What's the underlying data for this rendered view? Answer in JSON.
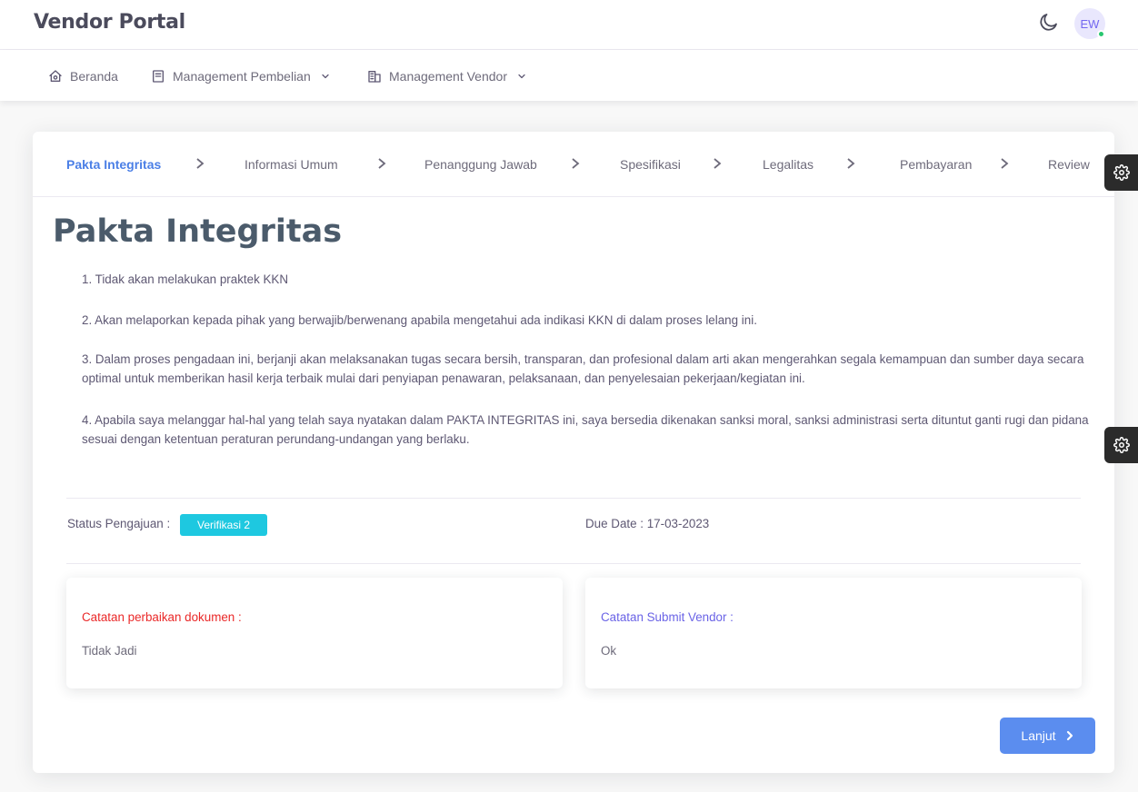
{
  "app": {
    "title": "Vendor Portal"
  },
  "user": {
    "initials": "EW",
    "status_color": "#28c76f"
  },
  "nav": {
    "items": [
      {
        "label": "Beranda",
        "icon": "home-icon"
      },
      {
        "label": "Management Pembelian",
        "icon": "document-icon",
        "has_dropdown": true
      },
      {
        "label": "Management Vendor",
        "icon": "building-icon",
        "has_dropdown": true
      }
    ]
  },
  "steps": [
    {
      "label": "Pakta Integritas",
      "active": true
    },
    {
      "label": "Informasi Umum"
    },
    {
      "label": "Penanggung Jawab"
    },
    {
      "label": "Spesifikasi"
    },
    {
      "label": "Legalitas"
    },
    {
      "label": "Pembayaran"
    },
    {
      "label": "Review"
    }
  ],
  "page": {
    "title": "Pakta Integritas",
    "items": [
      "1. Tidak akan melakukan praktek KKN",
      "2. Akan melaporkan kepada pihak yang berwajib/berwenang apabila mengetahui ada indikasi KKN di dalam proses lelang ini.",
      "3. Dalam proses pengadaan ini, berjanji akan melaksanakan tugas secara bersih, transparan, dan profesional dalam arti akan mengerahkan segala kemampuan dan sumber daya secara optimal untuk memberikan hasil kerja terbaik mulai dari penyiapan penawaran, pelaksanaan, dan penyelesaian pekerjaan/kegiatan ini.",
      "4. Apabila saya melanggar hal-hal yang telah saya nyatakan dalam PAKTA INTEGRITAS ini, saya bersedia dikenakan sanksi moral, sanksi administrasi serta dituntut ganti rugi dan pidana sesuai dengan ketentuan peraturan perundang-undangan yang berlaku."
    ]
  },
  "status": {
    "label": "Status Pengajuan :",
    "badge": "Verifikasi 2",
    "badge_color": "#1ec8e0",
    "due_label": "Due Date : 17-03-2023"
  },
  "notes": {
    "revision": {
      "title": "Catatan perbaikan dokumen :",
      "value": "Tidak Jadi",
      "color": "#ea2828"
    },
    "vendor": {
      "title": "Catatan Submit Vendor :",
      "value": "Ok",
      "color": "#6a63e6"
    }
  },
  "actions": {
    "next_label": "Lanjut"
  },
  "colors": {
    "primary": "#5b8def",
    "active_step": "#4b7fe6"
  }
}
